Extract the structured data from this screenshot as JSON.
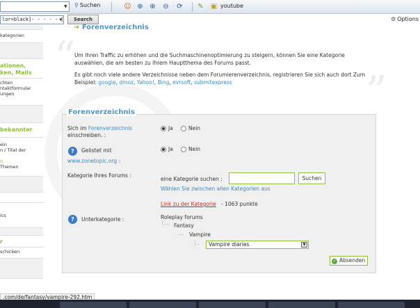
{
  "toolbar": {
    "search_button": "Suchen",
    "bookmark_label": "youtube",
    "options_label": "Options"
  },
  "left": {
    "input_value": "lor=black]- - - - - [/c",
    "search_button": "Search",
    "sections": [
      {
        "heading": "",
        "items": [
          "kategorien"
        ]
      },
      {
        "heading": "ationen,",
        "heading2": "ken, Mails",
        "items": [
          "chten",
          "ntaktformular",
          "ungen"
        ]
      },
      {
        "heading": "bekannter",
        "items": [
          "ein",
          "n / Titel der",
          "n",
          "Themen"
        ]
      },
      {
        "heading": "",
        "items": [
          "ics"
        ]
      },
      {
        "heading": "r",
        "items": [
          "schicken"
        ]
      }
    ]
  },
  "main": {
    "page_heading": "Forenverzeichnis",
    "intro_p1": "Um Ihren Traffic zu erhöhen und die Suchmaschinenoptimierung zu steigern, können Sie eine Kategorie auswählen, die am besten zu Ihrem Hauptthema des Forums passt.",
    "intro_p2_text": "Es gibt noch viele andere Verzeichnisse neben dem Forumierenverzeichnis, registrieren Sie sich auch dort Zum Beispiel:",
    "intro_links": [
      "google",
      "dmoz",
      "Yahoo!",
      "Bing",
      "evrsoft",
      "submitexpress"
    ]
  },
  "form": {
    "legend": "Forenverzeichnis",
    "q1_label_a": "Sich im",
    "q1_label_link": "Forenverzeichnis",
    "q1_label_b": "einschreiben. :",
    "yes": "Ja",
    "no": "Nein",
    "q2_label_a": "Gelistet mit",
    "q2_label_link": "www.zonetopic.org",
    "q2_label_b": ":",
    "category_label": "Kategorie Ihres Forums :",
    "category_search_label": "eine Kategorie suchen :",
    "category_search_button": "Suchen",
    "choose_all": "Wählen Sie zwischen allen Kategorien aus",
    "category_link": "Link zu der Kategorie",
    "category_points": "- 1063 punkte",
    "subcategory_label": "Unterkategorie :",
    "tree": [
      "Roleplay forums",
      "Fantasy",
      "Vampire"
    ],
    "select_value": "Vampire diaries",
    "submit": "Absenden"
  },
  "status": {
    "url": ".com/de/fantasy/vampire-292.htm"
  }
}
